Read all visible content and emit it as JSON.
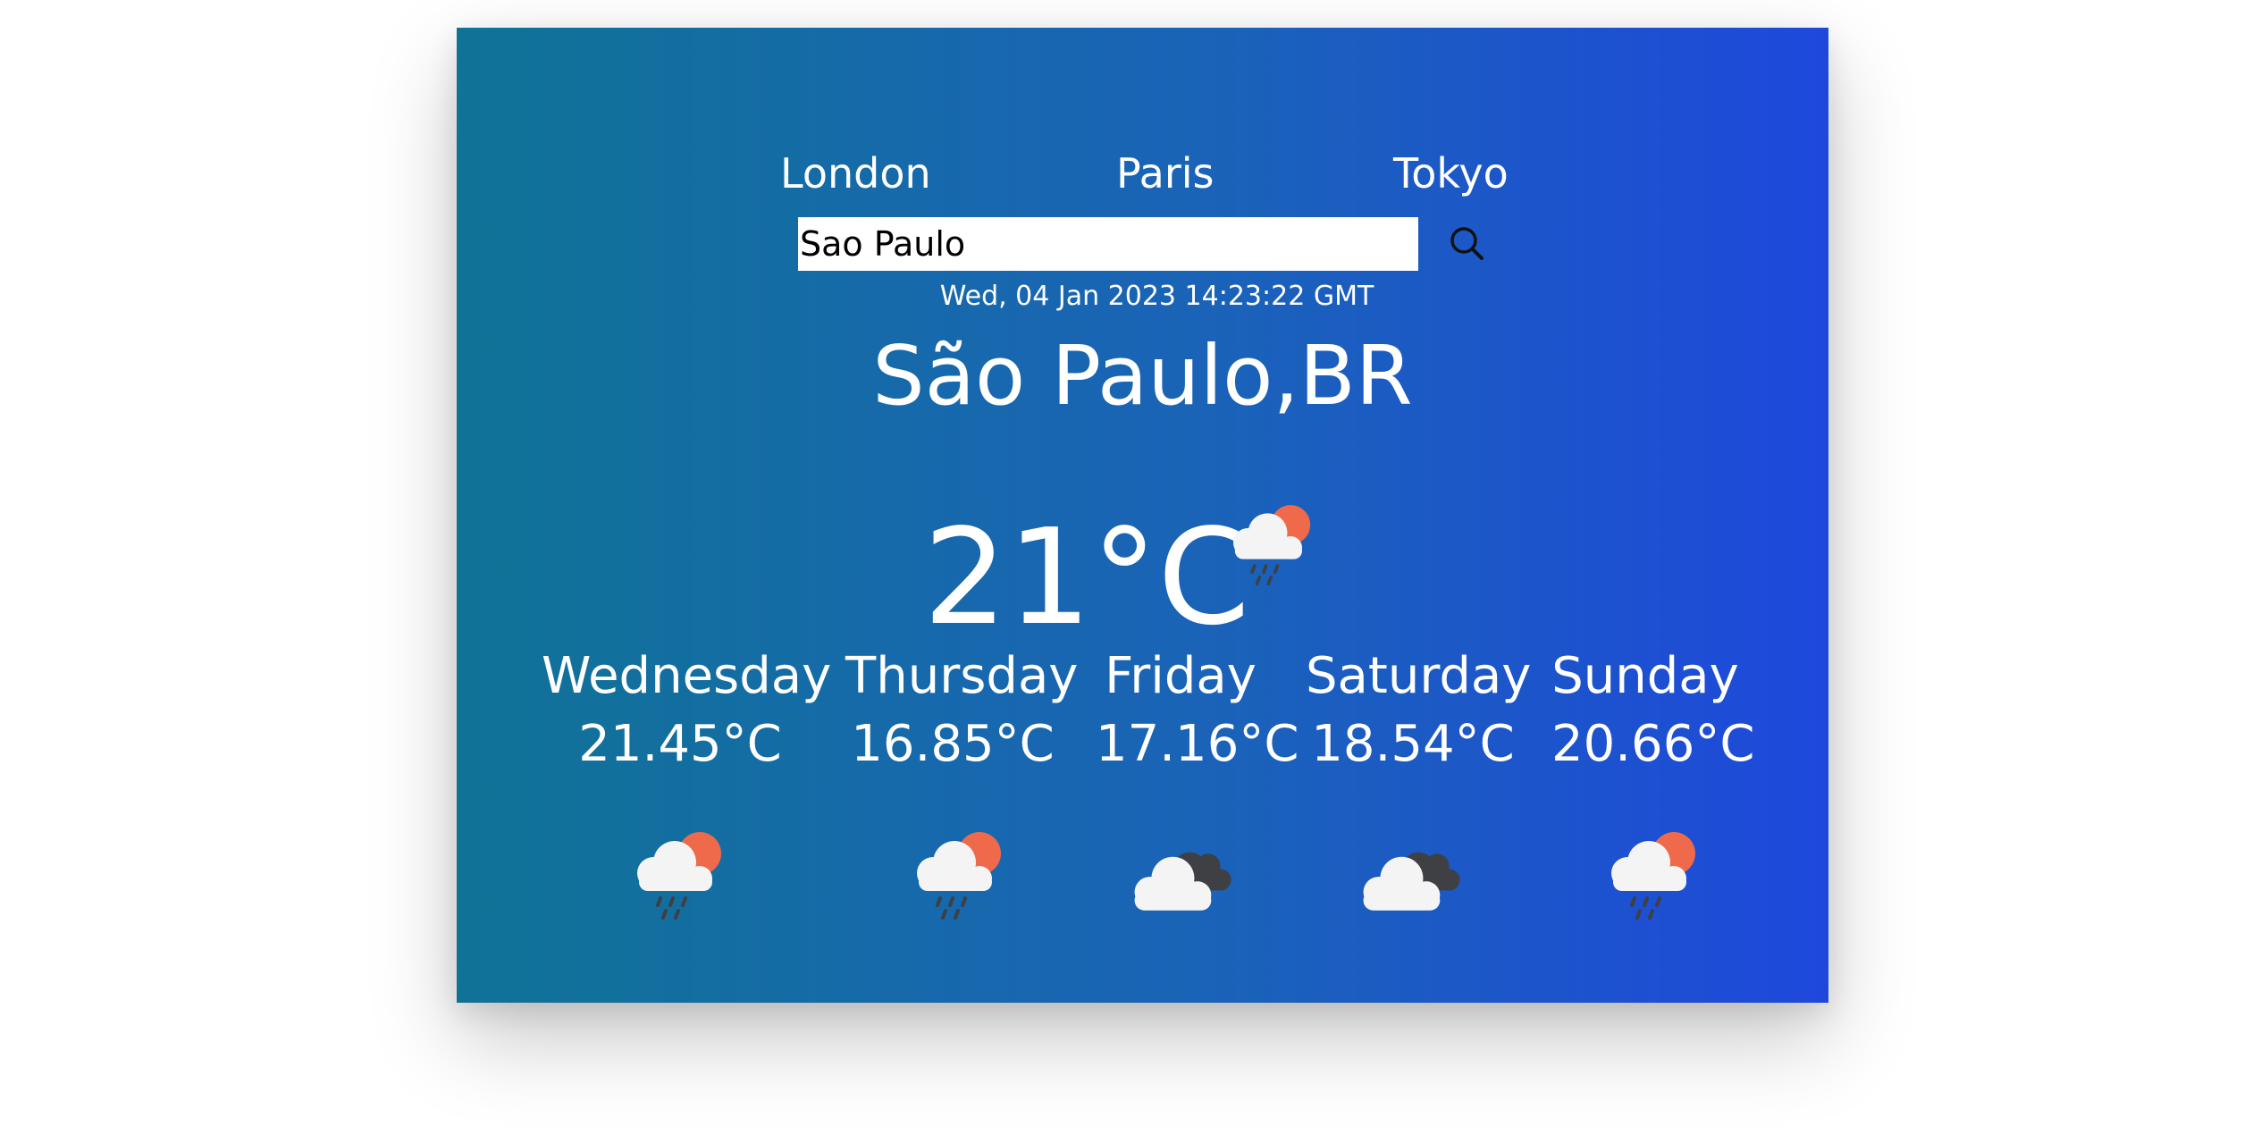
{
  "nav": {
    "cities": [
      "London",
      "Paris",
      "Tokyo"
    ]
  },
  "search": {
    "value": "Sao Paulo",
    "button_icon": "search-icon"
  },
  "datetime": "Wed, 04 Jan 2023 14:23:22 GMT",
  "location": "São Paulo,BR",
  "current": {
    "temperature": "21°C",
    "icon": "sun-cloud-rain-icon"
  },
  "forecast": [
    {
      "day": "Wednesday",
      "temp": "21.45°C",
      "icon": "sun-cloud-rain-icon"
    },
    {
      "day": "Thursday",
      "temp": "16.85°C",
      "icon": "sun-cloud-rain-icon"
    },
    {
      "day": "Friday",
      "temp": "17.16°C",
      "icon": "clouds-icon"
    },
    {
      "day": "Saturday",
      "temp": "18.54°C",
      "icon": "clouds-icon"
    },
    {
      "day": "Sunday",
      "temp": "20.66°C",
      "icon": "sun-cloud-rain-icon"
    }
  ],
  "colors": {
    "gradient_start": "#107396",
    "gradient_end": "#1e48dc",
    "sun": "#ee6a4a",
    "cloud": "#f4f4f4",
    "dark_cloud": "#3e4043",
    "rain": "#3e4043"
  }
}
